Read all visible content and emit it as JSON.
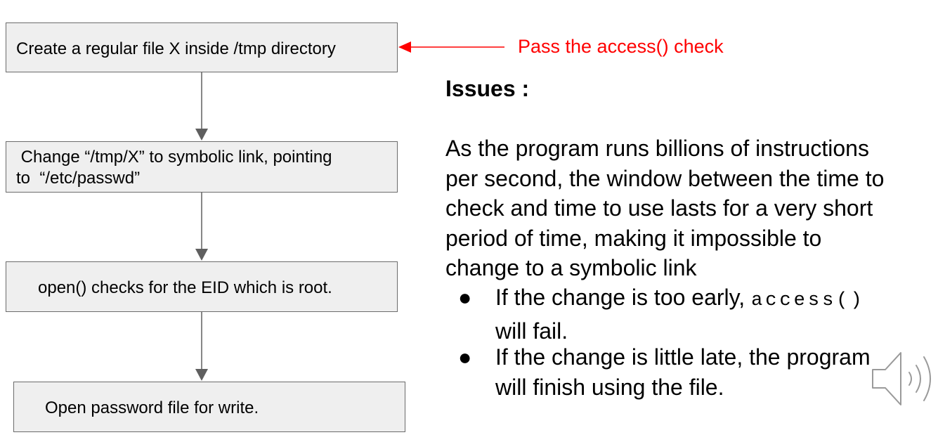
{
  "flowchart": {
    "steps": [
      {
        "line1": "Create a regular file X inside /tmp directory",
        "line2": ""
      },
      {
        "line1": " Change “/tmp/X” to symbolic link, pointing",
        "line2": "to  “/etc/passwd”"
      },
      {
        "line1": "open() checks for the EID which is root.",
        "line2": ""
      },
      {
        "line1": "Open password file for write.",
        "line2": ""
      }
    ]
  },
  "annotation": {
    "text": "Pass the access() check",
    "color": "#ff0000"
  },
  "issues": {
    "heading": "Issues :",
    "paragraph_lines": [
      "As the program runs billions of instructions",
      "per second, the window between the time to",
      "check and time to use lasts for a very short",
      "period of time, making it impossible to",
      "change to a symbolic link"
    ],
    "bullets": [
      {
        "bullet": "●",
        "line1_text": "If the change is too early, ",
        "line1_code": "access()",
        "line2": "will fail."
      },
      {
        "bullet": "●",
        "line1_text": "If the change is little late, the program",
        "line2": "will finish using the file."
      }
    ]
  },
  "icons": {
    "speaker": "speaker-audio-icon"
  }
}
